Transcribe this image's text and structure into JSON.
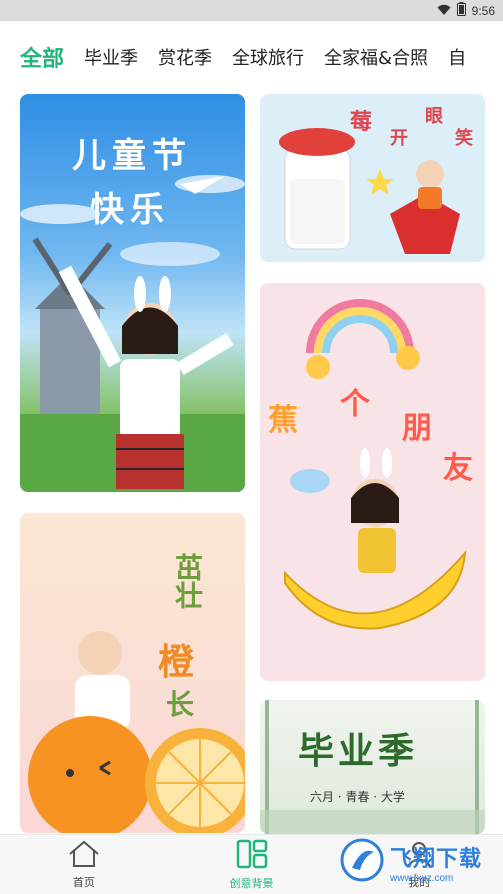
{
  "status_bar": {
    "time": "9:56"
  },
  "tabs": [
    {
      "label": "全部",
      "active": true
    },
    {
      "label": "毕业季",
      "active": false
    },
    {
      "label": "赏花季",
      "active": false
    },
    {
      "label": "全球旅行",
      "active": false
    },
    {
      "label": "全家福&合照",
      "active": false
    },
    {
      "label": "自",
      "active": false
    }
  ],
  "cards": {
    "card1": {
      "line1": "儿童节",
      "line2": "快乐"
    },
    "card2": {
      "chars": [
        "莓",
        "开",
        "眼",
        "笑"
      ]
    },
    "card3": {
      "chars": [
        "蕉",
        "个",
        "朋",
        "友"
      ]
    },
    "card4": {
      "line1": "茁壮",
      "line2": "橙",
      "line3": "长"
    },
    "card5": {
      "title": "毕业季",
      "subtitle": "六月 · 青春 · 大学"
    }
  },
  "bottom_nav": {
    "home": "首页",
    "creative": "创意背景",
    "mine": "我的"
  },
  "watermark": {
    "text": "飞翔下载",
    "sub": "www.fxxz.com"
  },
  "colors": {
    "accent": "#1fb57b",
    "watermark": "#2f7fdc"
  }
}
